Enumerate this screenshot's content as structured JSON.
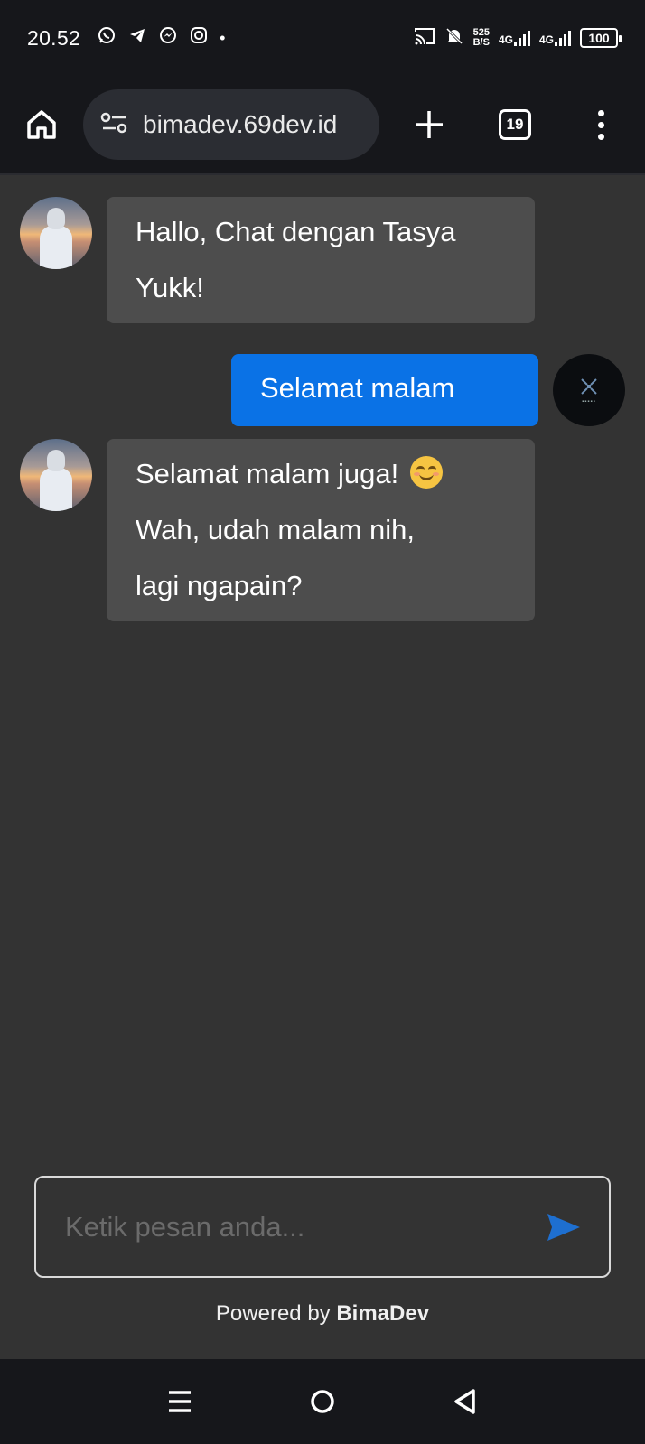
{
  "status_bar": {
    "time": "20.52",
    "net_speed_top": "525",
    "net_speed_bottom": "B/S",
    "net_type_1": "4G",
    "net_type_2": "4G",
    "battery": "100",
    "icons": [
      "whatsapp-icon",
      "telegram-icon",
      "messenger-icon",
      "instagram-icon",
      "cast-icon",
      "bell-off-icon",
      "signal-icon",
      "battery-icon"
    ]
  },
  "browser": {
    "url": "bimadev.69dev.id",
    "tab_count": "19"
  },
  "messages": [
    {
      "sender": "bot",
      "text": "Hallo, Chat dengan Tasya Yukk!"
    },
    {
      "sender": "user",
      "text": "Selamat malam"
    },
    {
      "sender": "bot",
      "line1": "Selamat malam juga!",
      "line2": "Wah, udah malam nih,",
      "line3": "lagi ngapain?"
    }
  ],
  "composer": {
    "placeholder": "Ketik pesan anda..."
  },
  "footer": {
    "powered_prefix": "Powered by",
    "powered_brand": "BimaDev"
  },
  "colors": {
    "background": "#333333",
    "bot_bubble": "#4d4d4d",
    "user_bubble": "#0a72e6",
    "send_accent": "#1e6fd0",
    "system_bar": "#16171b"
  }
}
